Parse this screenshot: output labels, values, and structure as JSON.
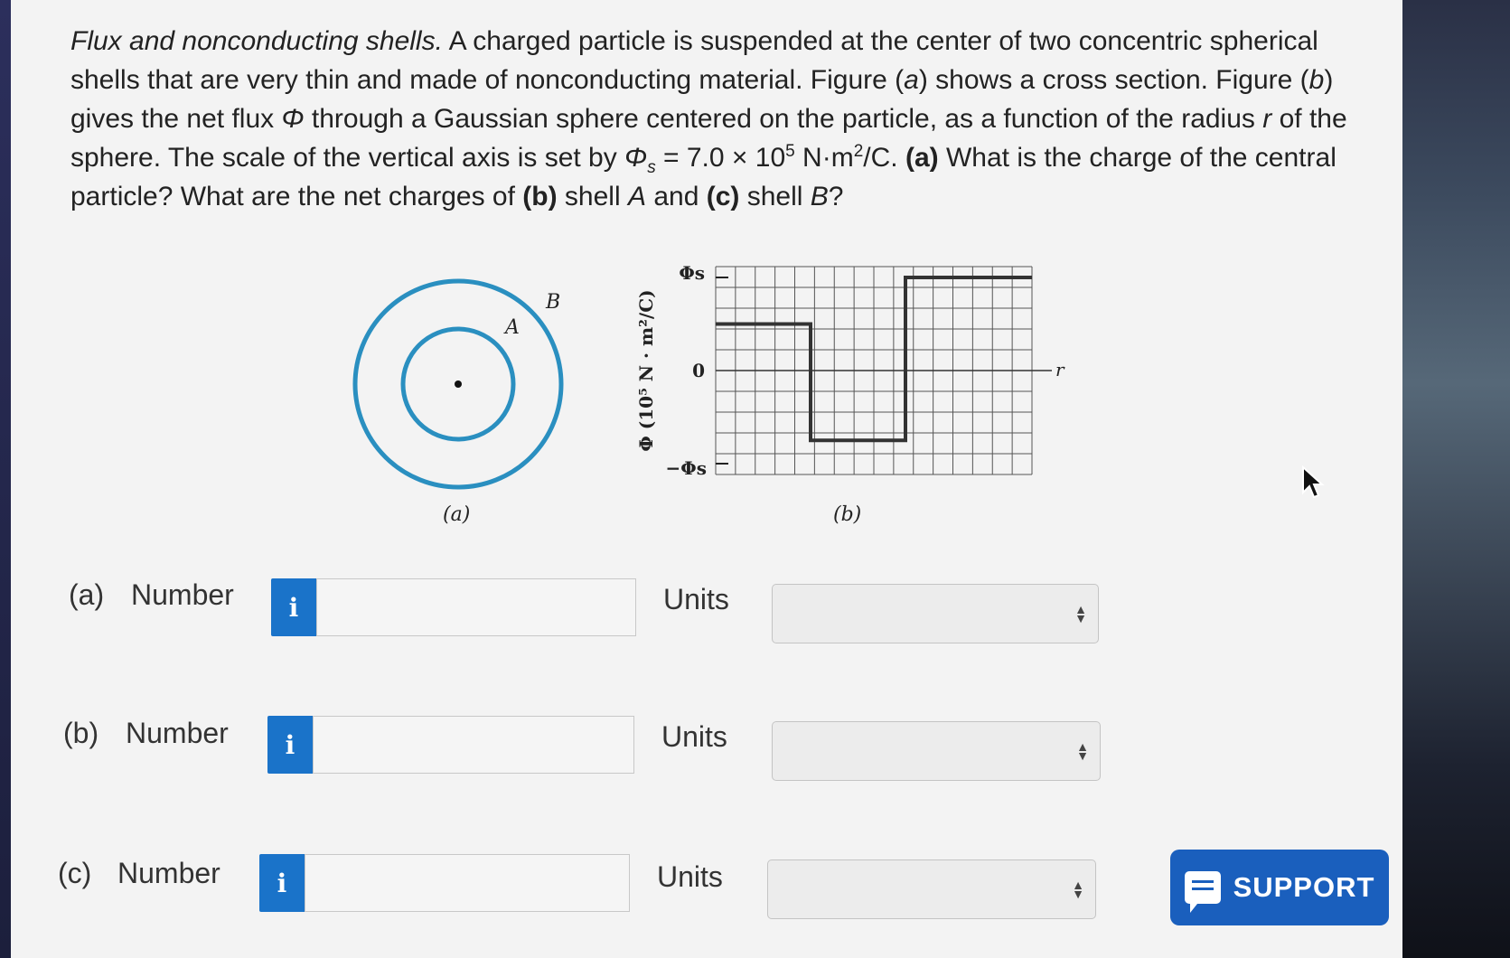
{
  "question": {
    "title": "Flux and nonconducting shells.",
    "text1": " A charged particle is suspended at the center of two concentric spherical shells that are very thin and made of nonconducting material. Figure (",
    "a_letter": "a",
    "text2": ") shows a cross section. Figure (",
    "b_letter": "b",
    "text3": ") gives the net flux ",
    "phi": "Φ",
    "text4": " through a Gaussian sphere centered on the particle, as a function of the radius ",
    "r": "r",
    "text5": " of the sphere. The scale of the vertical axis is set by ",
    "phi_s": "Φ",
    "s_sub": "s",
    "text6": " = 7.0 × 10",
    "exp5": "5",
    "text7": " N·m",
    "exp2": "2",
    "text8": "/C. ",
    "pa": "(a)",
    "text9": " What is the charge of the central particle? What are the net charges of ",
    "pb": "(b)",
    "text10": " shell ",
    "shellA": "A",
    "text11": " and ",
    "pc": "(c)",
    "text12": " shell ",
    "shellB": "B",
    "text13": "?"
  },
  "figure_a": {
    "label_A": "A",
    "label_B": "B",
    "caption": "(a)"
  },
  "figure_b": {
    "caption": "(b)",
    "y_axis_label": "Φ (10⁵ N · m²/C)",
    "y_tick_top": "Φs",
    "y_tick_zero": "0",
    "y_tick_bottom": "−Φs",
    "x_axis_label": "r"
  },
  "chart_data": {
    "type": "line",
    "x_label": "r",
    "y_label": "Φ (10⁵ N · m²/C)",
    "y_ticks": [
      "−Φs",
      "0",
      "Φs"
    ],
    "ylim": [
      -1,
      1
    ],
    "grid": true,
    "points": [
      {
        "x": 0,
        "y": 0.5
      },
      {
        "x": 3,
        "y": 0.5
      },
      {
        "x": 3,
        "y": -0.75
      },
      {
        "x": 6,
        "y": -0.75
      },
      {
        "x": 6,
        "y": 1.0
      },
      {
        "x": 10,
        "y": 1.0
      }
    ],
    "xlim": [
      0,
      10
    ]
  },
  "answers": [
    {
      "label": "(a)",
      "number_label": "Number",
      "info_icon": "i",
      "value": "",
      "units_label": "Units",
      "units_value": ""
    },
    {
      "label": "(b)",
      "number_label": "Number",
      "info_icon": "i",
      "value": "",
      "units_label": "Units",
      "units_value": ""
    },
    {
      "label": "(c)",
      "number_label": "Number",
      "info_icon": "i",
      "value": "",
      "units_label": "Units",
      "units_value": ""
    }
  ],
  "support": {
    "label": "SUPPORT",
    "icon": "chat-icon"
  },
  "colors": {
    "accent": "#1a73c9",
    "support": "#1a5fbd",
    "shell": "#2a8fc0"
  }
}
